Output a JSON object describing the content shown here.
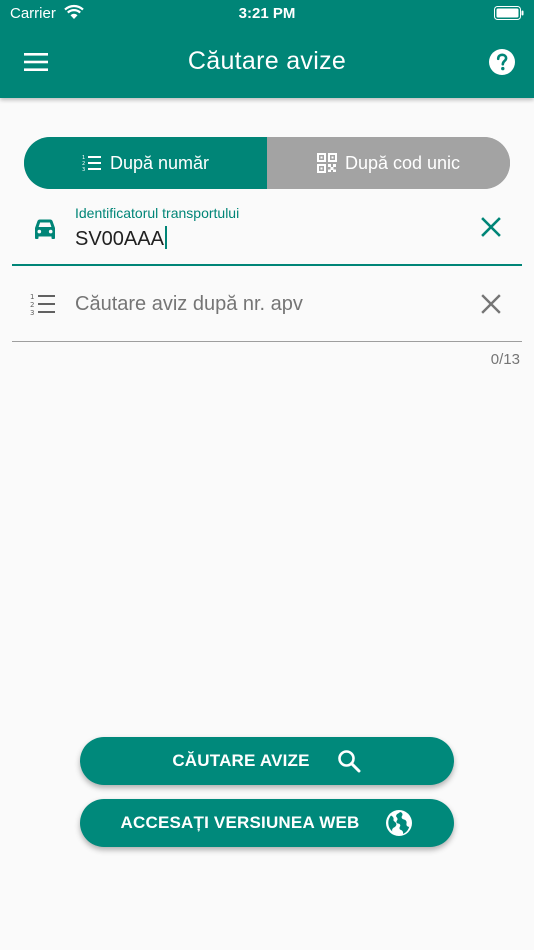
{
  "status_bar": {
    "carrier": "Carrier",
    "time": "3:21 PM"
  },
  "header": {
    "title": "Căutare avize",
    "menu_icon": "hamburger-menu-icon",
    "help_icon": "help-circle-icon"
  },
  "tabs": [
    {
      "label": "După număr",
      "icon": "numbered-list-icon",
      "active": true
    },
    {
      "label": "După cod unic",
      "icon": "qr-code-icon",
      "active": false
    }
  ],
  "fields": {
    "transport_id": {
      "label": "Identificatorul transportului",
      "value": "SV00AAA",
      "icon": "car-icon"
    },
    "apv_search": {
      "placeholder": "Căutare aviz după nr. apv",
      "icon": "numbered-list-icon"
    },
    "counter": "0/13"
  },
  "buttons": {
    "search": {
      "label": "CĂUTARE AVIZE",
      "icon": "search-icon"
    },
    "web": {
      "label": "ACCESAȚI VERSIUNEA WEB",
      "icon": "globe-icon"
    }
  },
  "colors": {
    "primary": "#008577",
    "inactive_tab": "#a3a3a3",
    "background": "#fafafa"
  }
}
